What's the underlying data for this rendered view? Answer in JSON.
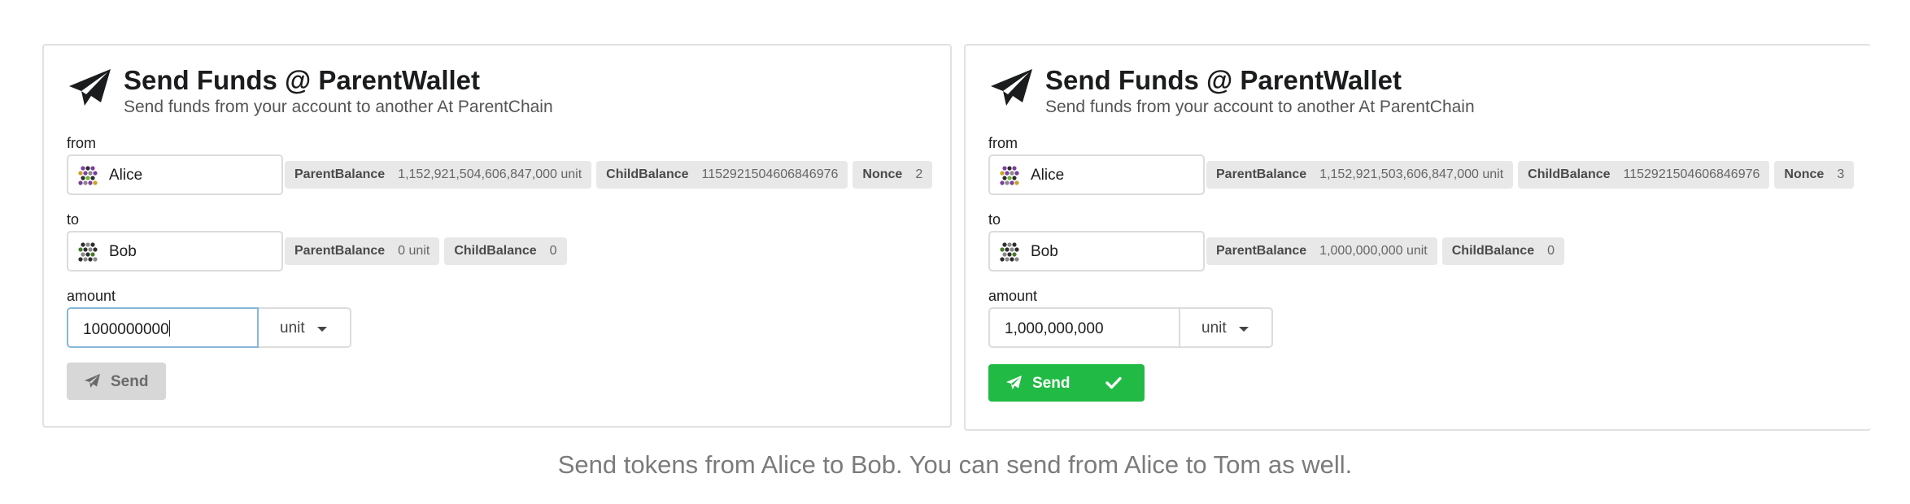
{
  "panels": [
    {
      "title": "Send Funds @ ParentWallet",
      "subtitle": "Send funds from your account to another At ParentChain",
      "from_label": "from",
      "from_account": "Alice",
      "from_badges": [
        {
          "key": "ParentBalance",
          "value": "1,152,921,504,606,847,000 unit"
        },
        {
          "key": "ChildBalance",
          "value": "1152921504606846976"
        },
        {
          "key": "Nonce",
          "value": "2"
        }
      ],
      "to_label": "to",
      "to_account": "Bob",
      "to_badges": [
        {
          "key": "ParentBalance",
          "value": "0 unit"
        },
        {
          "key": "ChildBalance",
          "value": "0"
        }
      ],
      "amount_label": "amount",
      "amount_value": "1000000000",
      "unit": "unit",
      "send_label": "Send",
      "send_state": "disabled"
    },
    {
      "title": "Send Funds @ ParentWallet",
      "subtitle": "Send funds from your account to another At ParentChain",
      "from_label": "from",
      "from_account": "Alice",
      "from_badges": [
        {
          "key": "ParentBalance",
          "value": "1,152,921,503,606,847,000 unit"
        },
        {
          "key": "ChildBalance",
          "value": "1152921504606846976"
        },
        {
          "key": "Nonce",
          "value": "3"
        }
      ],
      "to_label": "to",
      "to_account": "Bob",
      "to_badges": [
        {
          "key": "ParentBalance",
          "value": "1,000,000,000 unit"
        },
        {
          "key": "ChildBalance",
          "value": "0"
        }
      ],
      "amount_label": "amount",
      "amount_value": "1,000,000,000",
      "unit": "unit",
      "send_label": "Send",
      "send_state": "success"
    }
  ],
  "caption": "Send tokens from Alice to Bob. You can send from Alice to Tom as well.",
  "colors": {
    "success": "#21ba45",
    "disabled": "#d7d7d7",
    "focus_border": "#85b7d9"
  },
  "icons": {
    "header": "paper-plane-icon",
    "send": "paper-plane-icon",
    "confirm": "check-icon",
    "avatar": "identicon-avatar"
  }
}
